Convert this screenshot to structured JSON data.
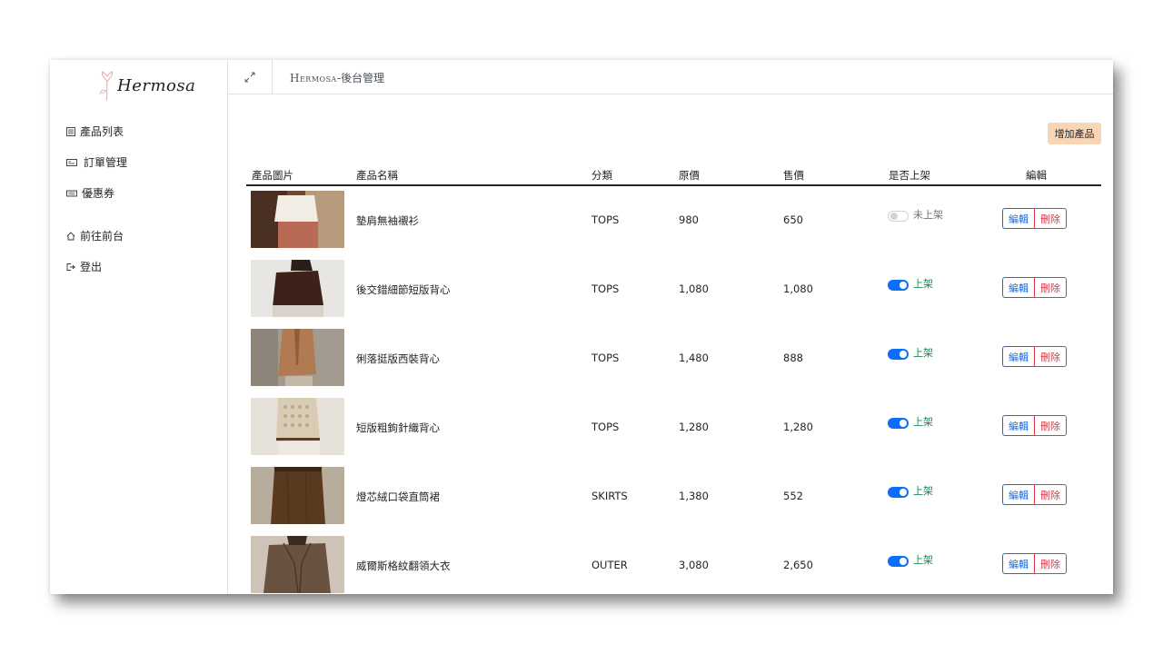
{
  "brand": {
    "logo_text": "Hermosa"
  },
  "sidebar": {
    "items": [
      {
        "label": "產品列表",
        "icon": "list-icon"
      },
      {
        "label": "訂單管理",
        "icon": "receipt-icon"
      },
      {
        "label": "優惠券",
        "icon": "ticket-icon"
      },
      {
        "label": "前往前台",
        "icon": "home-icon"
      },
      {
        "label": "登出",
        "icon": "logout-icon"
      }
    ]
  },
  "topbar": {
    "brand": "Hermosa",
    "suffix": "-後台管理"
  },
  "toolbar": {
    "add_label": "增加產品"
  },
  "table": {
    "headers": [
      "產品圖片",
      "產品名稱",
      "分類",
      "原價",
      "售價",
      "是否上架",
      "編輯"
    ],
    "edit_label": "編輯",
    "delete_label": "刪除",
    "rows": [
      {
        "name": "墊肩無袖襯衫",
        "category": "TOPS",
        "origin_price": "980",
        "price": "650",
        "status": "未上架",
        "enabled": false
      },
      {
        "name": "後交錯細節短版背心",
        "category": "TOPS",
        "origin_price": "1,080",
        "price": "1,080",
        "status": "上架",
        "enabled": true
      },
      {
        "name": "俐落挺版西裝背心",
        "category": "TOPS",
        "origin_price": "1,480",
        "price": "888",
        "status": "上架",
        "enabled": true
      },
      {
        "name": "短版粗鉤針織背心",
        "category": "TOPS",
        "origin_price": "1,280",
        "price": "1,280",
        "status": "上架",
        "enabled": true
      },
      {
        "name": "燈芯絨口袋直筒裙",
        "category": "SKIRTS",
        "origin_price": "1,380",
        "price": "552",
        "status": "上架",
        "enabled": true
      },
      {
        "name": "威爾斯格紋翻領大衣",
        "category": "OUTER",
        "origin_price": "3,080",
        "price": "2,650",
        "status": "上架",
        "enabled": true
      }
    ]
  },
  "colors": {
    "accent": "#0d6efd",
    "danger": "#dc3545",
    "success": "#198754",
    "add_button": "#f8d5b5"
  }
}
